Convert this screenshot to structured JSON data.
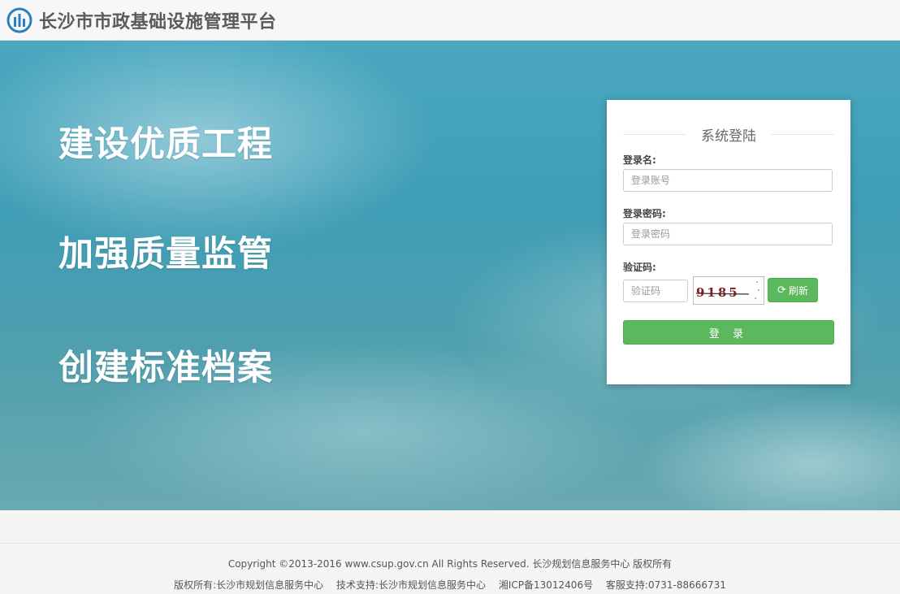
{
  "header": {
    "title": "长沙市市政基础设施管理平台",
    "logo_icon": "city-skyline-logo"
  },
  "hero": {
    "slogans": [
      "建设优质工程",
      "加强质量监管",
      "创建标准档案"
    ]
  },
  "login": {
    "title": "系统登陆",
    "username_label": "登录名:",
    "username_placeholder": "登录账号",
    "password_label": "登录密码:",
    "password_placeholder": "登录密码",
    "captcha_label": "验证码:",
    "captcha_placeholder": "验证码",
    "captcha_text": "9185",
    "refresh_label": "刷新",
    "submit_label": "登 录"
  },
  "footer": {
    "copyright": "Copyright ©2013-2016 www.csup.gov.cn All Rights Reserved. 长沙规划信息服务中心 版权所有",
    "owner": "版权所有:长沙市规划信息服务中心",
    "support": "技术支持:长沙市规划信息服务中心",
    "icp": "湘ICP备13012406号",
    "hotline": "客服支持:0731-88666731"
  },
  "colors": {
    "accent_green": "#5cb85c",
    "hero_blue": "#3f9db6",
    "header_text": "#5b5b5b"
  }
}
